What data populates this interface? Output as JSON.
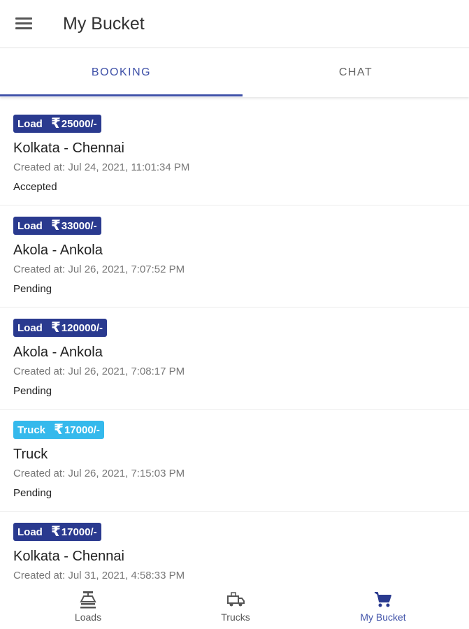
{
  "app_bar": {
    "title": "My Bucket"
  },
  "tabs": [
    {
      "label": "BOOKING",
      "active": true
    },
    {
      "label": "CHAT",
      "active": false
    }
  ],
  "colors": {
    "accent": "#3f51a8",
    "load_badge": "#2a3a8f",
    "truck_badge": "#35b9ec"
  },
  "bookings": [
    {
      "type": "Load",
      "amount": "25000/-",
      "route": "Kolkata - Chennai",
      "created": "Created at: Jul 24, 2021, 11:01:34 PM",
      "status": "Accepted"
    },
    {
      "type": "Load",
      "amount": "33000/-",
      "route": "Akola - Ankola",
      "created": "Created at: Jul 26, 2021, 7:07:52 PM",
      "status": "Pending"
    },
    {
      "type": "Load",
      "amount": "120000/-",
      "route": "Akola - Ankola",
      "created": "Created at: Jul 26, 2021, 7:08:17 PM",
      "status": "Pending"
    },
    {
      "type": "Truck",
      "amount": "17000/-",
      "route": "Truck",
      "created": "Created at: Jul 26, 2021, 7:15:03 PM",
      "status": "Pending"
    },
    {
      "type": "Load",
      "amount": "17000/-",
      "route": "Kolkata - Chennai",
      "created": "Created at: Jul 31, 2021, 4:58:33 PM",
      "status": ""
    }
  ],
  "currency_symbol": "₹",
  "bottom_nav": [
    {
      "label": "Loads",
      "icon": "scale-icon",
      "active": false
    },
    {
      "label": "Trucks",
      "icon": "truck-icon",
      "active": false
    },
    {
      "label": "My Bucket",
      "icon": "cart-icon",
      "active": true
    }
  ]
}
